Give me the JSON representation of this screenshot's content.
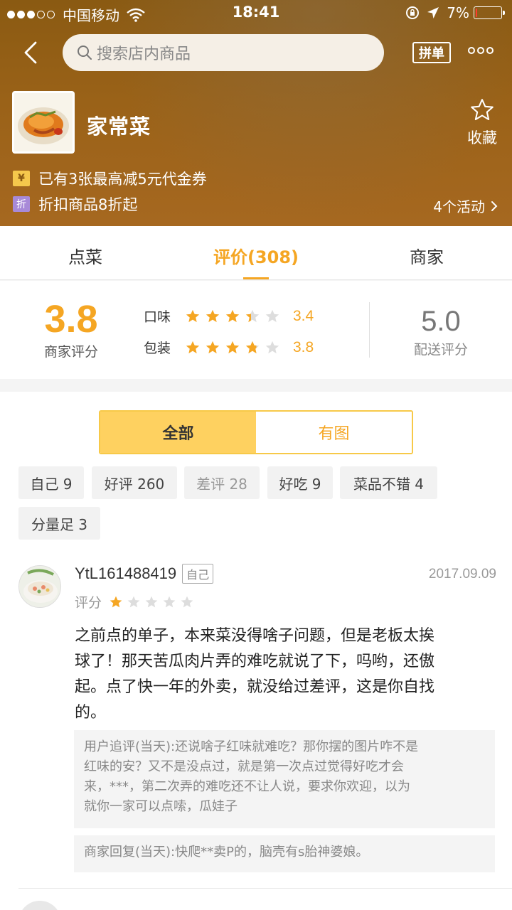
{
  "status_bar": {
    "carrier": "中国移动",
    "time": "18:41",
    "battery_percent": "7%",
    "signal_bars_filled": 3,
    "signal_bars_total": 5,
    "battery_level": 0.07
  },
  "nav": {
    "search_placeholder": "搜索店内商品",
    "group_order_label": "拼单"
  },
  "store": {
    "name": "家常菜",
    "favorite_label": "收藏",
    "promos": [
      {
        "tag": "¥",
        "text": "已有3张最高减5元代金券"
      },
      {
        "tag": "折",
        "text": "折扣商品8折起"
      }
    ],
    "activities_label": "4个活动"
  },
  "tabs": [
    {
      "label": "点菜",
      "active": false
    },
    {
      "label": "评价(308)",
      "active": true
    },
    {
      "label": "商家",
      "active": false
    }
  ],
  "ratings": {
    "merchant_score": "3.8",
    "merchant_score_label": "商家评分",
    "rows": [
      {
        "label": "口味",
        "stars": 3.4,
        "value": "3.4"
      },
      {
        "label": "包装",
        "stars": 3.8,
        "value": "3.8"
      }
    ],
    "delivery_score": "5.0",
    "delivery_label": "配送评分"
  },
  "filter": {
    "segments": [
      {
        "label": "全部",
        "active": true
      },
      {
        "label": "有图",
        "active": false
      }
    ],
    "chips": [
      {
        "label": "自己 9",
        "muted": false
      },
      {
        "label": "好评 260",
        "muted": false
      },
      {
        "label": "差评 28",
        "muted": true
      },
      {
        "label": "好吃 9",
        "muted": false
      },
      {
        "label": "菜品不错 4",
        "muted": false
      },
      {
        "label": "分量足 3",
        "muted": false
      }
    ]
  },
  "review": {
    "username": "YtL161488419",
    "self_badge": "自己",
    "date": "2017.09.09",
    "rating_label": "评分",
    "stars": 1,
    "text_lines": [
      "之前点的单子，本来菜没得啥子问题，但是老板太挨",
      "球了！那天苦瓜肉片弄的难吃就说了下，吗哟，还傲",
      "起。点了快一年的外卖，就没给过差评，这是你自找",
      "的。"
    ],
    "followup_lines": [
      "用户追评(当天):还说啥子红味就难吃？那你摆的图片咋不是",
      "红味的安？又不是没点过，就是第一次点过觉得好吃才会",
      "来，***，第二次弄的难吃还不让人说，要求你欢迎，以为",
      "就你一家可以点嗦，瓜娃子"
    ],
    "merchant_reply": "商家回复(当天):快爬**卖P的，脑壳有s胎神婆娘。"
  },
  "colors": {
    "accent": "#f5a623",
    "header_brown": "#9a6218",
    "segment_yellow": "#fed160",
    "star_empty": "#dddddd"
  }
}
